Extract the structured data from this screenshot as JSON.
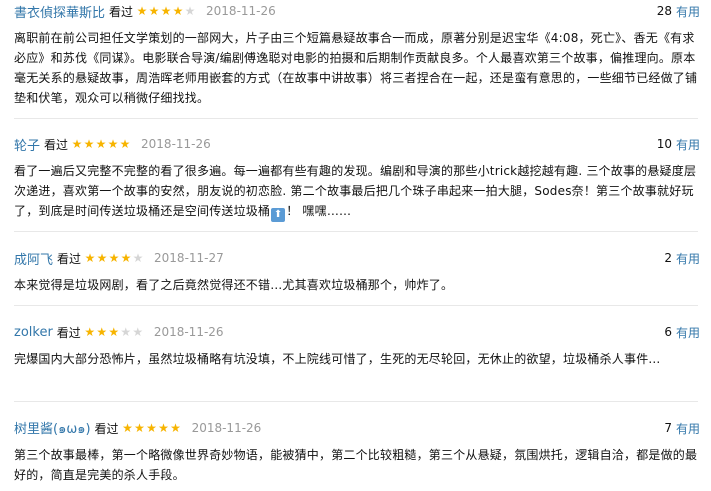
{
  "reviews": [
    {
      "user": "書衣偵探華斯比",
      "status": "看过",
      "rating": 4,
      "date": "2018-11-26",
      "useful_count": "28",
      "useful_label": "有用",
      "content": "离职前在前公司担任文学策划的一部网大，片子由三个短篇悬疑故事合一而成，原著分别是迟宝华《4:08，死亡》、香无《有求必应》和苏伐《同谋》。电影联合导演/编剧傅逸聪对电影的拍摄和后期制作贡献良多。个人最喜欢第三个故事，偏推理向。原本毫无关系的悬疑故事，周浩晖老师用嵌套的方式（在故事中讲故事）将三者捏合在一起，还是蛮有意思的，一些细节已经做了铺垫和伏笔，观众可以稍微仔细找找。"
    },
    {
      "user": "轮子",
      "status": "看过",
      "rating": 5,
      "date": "2018-11-26",
      "useful_count": "10",
      "useful_label": "有用",
      "content": "看了一遍后又完整不完整的看了很多遍。每一遍都有些有趣的发现。编剧和导演的那些小trick越挖越有趣. 三个故事的悬疑度层次递进，喜欢第一个故事的安然，朋友说的初恋脸. 第二个故事最后把几个珠子串起来一拍大腿，Sodes奈！第三个故事就好玩了，到底是时间传送垃圾桶还是空间传送垃圾桶",
      "content_tail": "！ 嘿嘿……",
      "emoji": "⬆"
    },
    {
      "user": "成阿飞",
      "status": "看过",
      "rating": 4,
      "date": "2018-11-27",
      "useful_count": "2",
      "useful_label": "有用",
      "content": "本来觉得是垃圾网剧，看了之后竟然觉得还不错…尤其喜欢垃圾桶那个，帅炸了。"
    },
    {
      "user": "zolker",
      "status": "看过",
      "rating": 3,
      "date": "2018-11-26",
      "useful_count": "6",
      "useful_label": "有用",
      "content": "完爆国内大部分恐怖片，虽然垃圾桶略有坑没填，不上院线可惜了，生死的无尽轮回，无休止的欲望，垃圾桶杀人事件..."
    },
    {
      "user": "树里酱(๑ω๑)",
      "status": "看过",
      "rating": 5,
      "date": "2018-11-26",
      "useful_count": "7",
      "useful_label": "有用",
      "content": "第三个故事最棒，第一个略微像世界奇妙物语，能被猜中，第二个比较粗糙，第三个从悬疑，氛围烘托，逻辑自洽，都是做的最好的，简直是完美的杀人手段。"
    }
  ]
}
